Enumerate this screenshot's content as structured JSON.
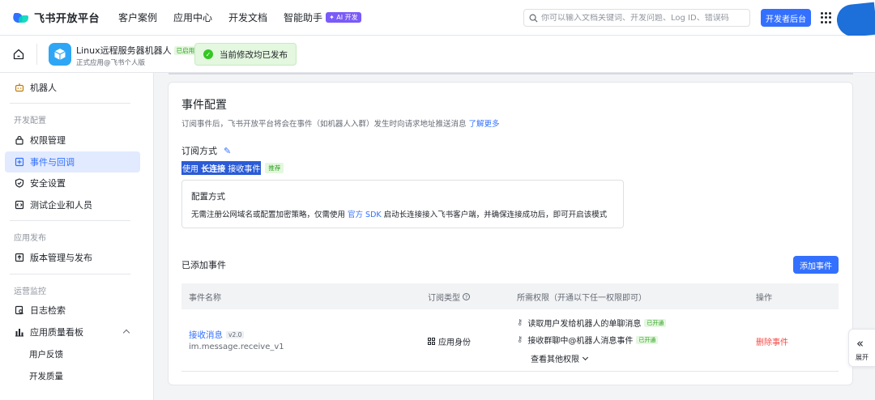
{
  "header": {
    "logo_text": "飞书开放平台",
    "nav": [
      "客户案例",
      "应用中心",
      "开发文档",
      "智能助手"
    ],
    "ai_badge": "✦ AI 开发",
    "search_placeholder": "你可以输入文档关键词、开发问题、Log ID、错误码",
    "dev_console_label": "开发者后台"
  },
  "app": {
    "name": "Linux远程服务器机器人",
    "status_tag": "已启用",
    "subtitle": "正式应用@飞书个人版",
    "publish_status": "当前修改均已发布"
  },
  "sidebar": {
    "top_item": "机器人",
    "groups": {
      "dev_config": "开发配置",
      "app_release": "应用发布",
      "ops_monitor": "运营监控"
    },
    "items": {
      "permissions": "权限管理",
      "events": "事件与回调",
      "security": "安全设置",
      "test_company": "测试企业和人员",
      "version": "版本管理与发布",
      "logs": "日志检索",
      "quality": "应用质量看板",
      "feedback": "用户反馈",
      "dev_quality": "开发质量"
    },
    "active": "events"
  },
  "event_config": {
    "title": "事件配置",
    "description": "订阅事件后，飞书开放平台将会在事件（如机器人入群）发生时向请求地址推送消息",
    "learn_more": "了解更多",
    "subscribe_label": "订阅方式",
    "mode_prefix": "使用 ",
    "mode_bold": "长连接",
    "mode_suffix": " 接收事件",
    "recommend_tag": "推荐",
    "config_title": "配置方式",
    "config_text_1": "无需注册公网域名或配置加密策略，仅需使用 ",
    "config_link": "官方 SDK",
    "config_text_2": " 启动长连接接入飞书客户端，并确保连接成功后，即可开启该模式"
  },
  "added_events": {
    "title": "已添加事件",
    "add_button": "添加事件",
    "columns": [
      "事件名称",
      "订阅类型",
      "所需权限（开通以下任一权限即可）",
      "操作"
    ],
    "rows": [
      {
        "name": "接收消息",
        "version": "v2.0",
        "code": "im.message.receive_v1",
        "type": "应用身份",
        "permissions": [
          {
            "label": "读取用户发给机器人的单聊消息",
            "status": "已开通"
          },
          {
            "label": "接收群聊中@机器人消息事件",
            "status": "已开通"
          }
        ],
        "more_perms": "查看其他权限",
        "action": "删除事件"
      }
    ]
  },
  "expand_panel": {
    "label": "展开"
  },
  "colors": {
    "primary": "#3370ff",
    "success": "#34c724",
    "danger": "#f54a45"
  }
}
